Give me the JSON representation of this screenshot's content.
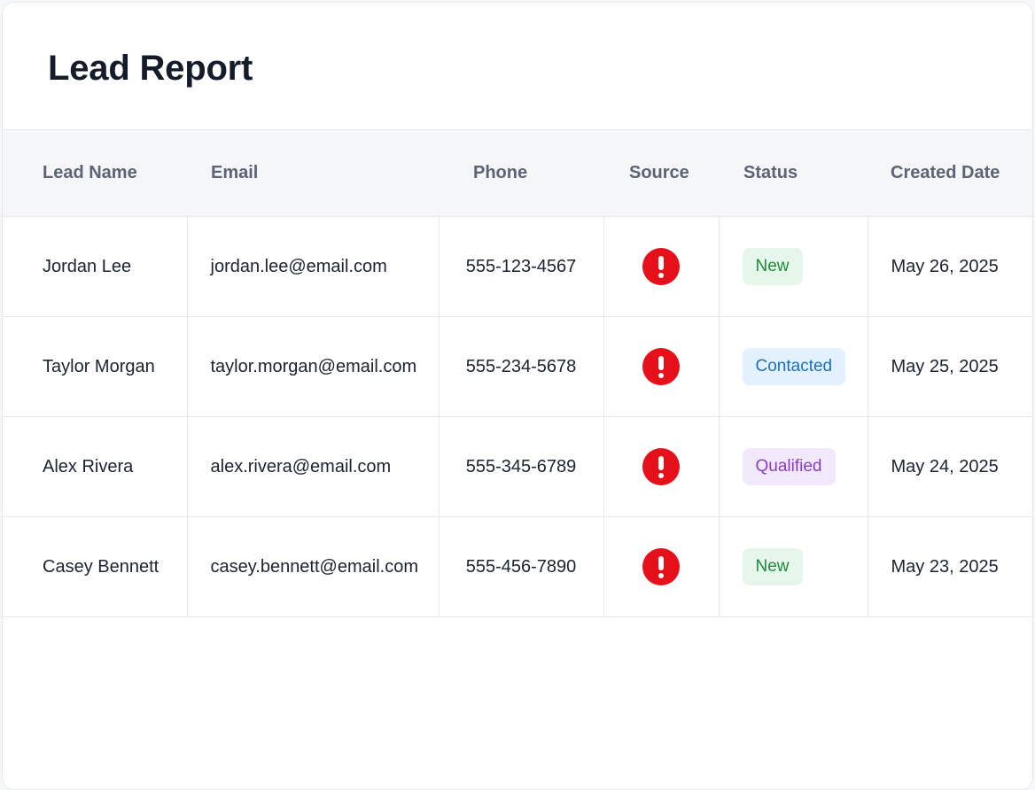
{
  "page": {
    "title": "Lead Report"
  },
  "table": {
    "columns": [
      "Lead Name",
      "Email",
      "Phone",
      "Source",
      "Status",
      "Created Date"
    ],
    "rows": [
      {
        "name": "Jordan Lee",
        "email": "jordan.lee@email.com",
        "phone": "555-123-4567",
        "source_icon": "alert-icon",
        "status": "New",
        "status_style": {
          "bg": "#e7f6ea",
          "fg": "#1e8a3a"
        },
        "created": "May 26, 2025"
      },
      {
        "name": "Taylor Morgan",
        "email": "taylor.morgan@email.com",
        "phone": "555-234-5678",
        "source_icon": "alert-icon",
        "status": "Contacted",
        "status_style": {
          "bg": "#e3f0fd",
          "fg": "#1f6fb8"
        },
        "created": "May 25, 2025"
      },
      {
        "name": "Alex Rivera",
        "email": "alex.rivera@email.com",
        "phone": "555-345-6789",
        "source_icon": "alert-icon",
        "status": "Qualified",
        "status_style": {
          "bg": "#f1e8fb",
          "fg": "#8a3cc4"
        },
        "created": "May 24, 2025"
      },
      {
        "name": "Casey Bennett",
        "email": "casey.bennett@email.com",
        "phone": "555-456-7890",
        "source_icon": "alert-icon",
        "status": "New",
        "status_style": {
          "bg": "#e7f6ea",
          "fg": "#1e8a3a"
        },
        "created": "May 23, 2025"
      }
    ]
  },
  "colors": {
    "title": "#141c2b",
    "header_bg": "#f5f6f8",
    "header_text": "#5a6475",
    "alert": "#e5101a",
    "border": "#e6e8ec"
  }
}
